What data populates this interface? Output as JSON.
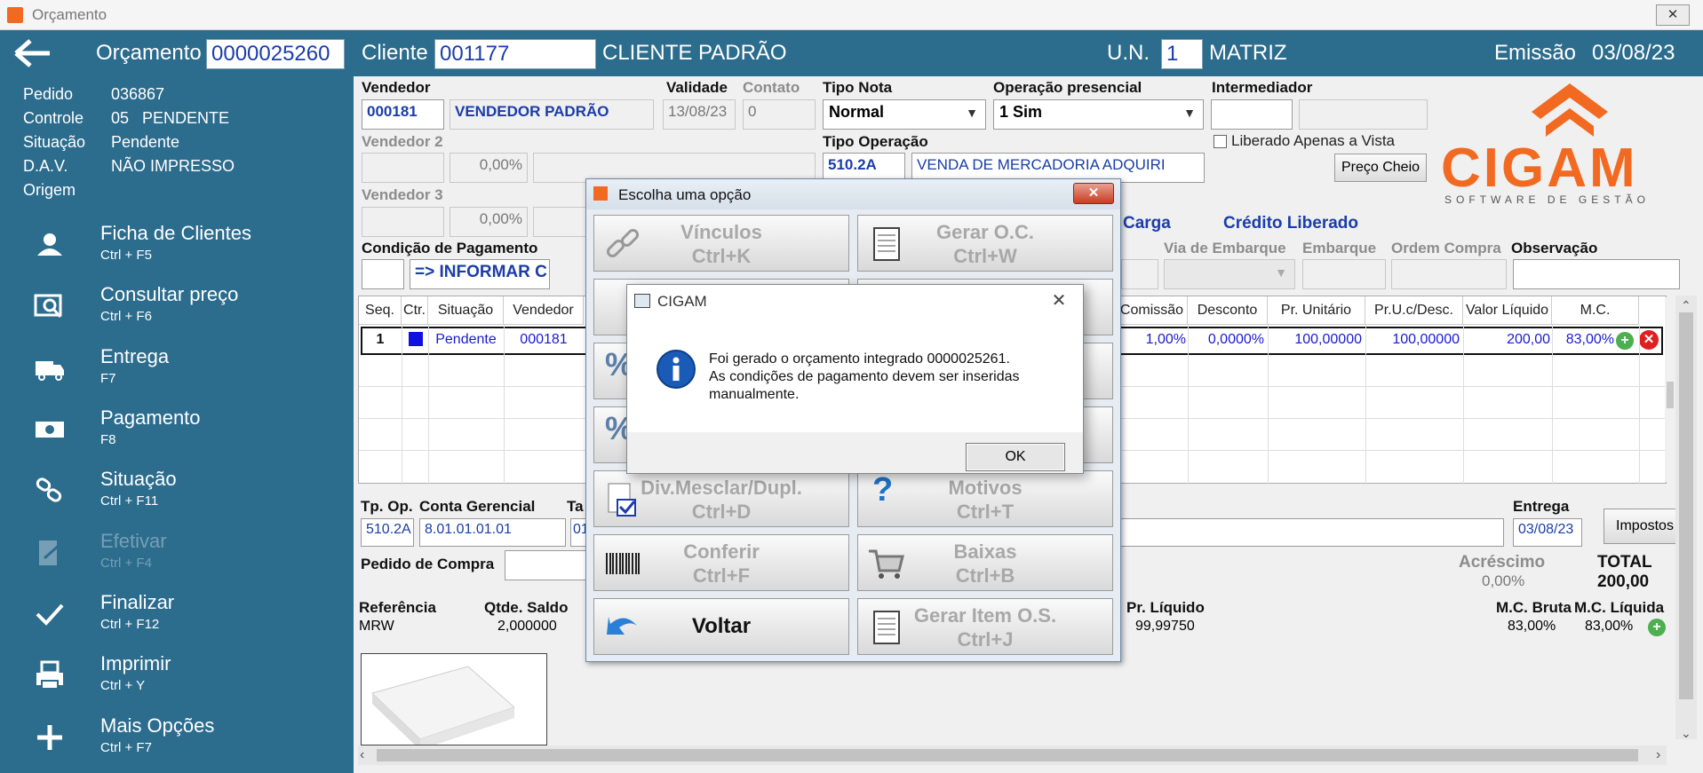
{
  "window": {
    "title": "Orçamento",
    "close_glyph": "✕"
  },
  "header": {
    "back_icon": "arrow-left-icon",
    "orcamento_label": "Orçamento",
    "orcamento_value": "0000025260",
    "cliente_label": "Cliente",
    "cliente_code": "001177",
    "cliente_name": "CLIENTE PADRÃO",
    "un_label": "U.N.",
    "un_value": "1",
    "un_name": "MATRIZ",
    "emissao_label": "Emissão",
    "emissao_value": "03/08/23"
  },
  "sidebar": {
    "info": [
      {
        "label": "Pedido",
        "value": "036867"
      },
      {
        "label": "Controle",
        "value": "05   PENDENTE"
      },
      {
        "label": "Situação",
        "value": "Pendente"
      },
      {
        "label": "D.A.V.",
        "value": "NÃO IMPRESSO"
      },
      {
        "label": "Origem",
        "value": ""
      }
    ],
    "menu": [
      {
        "label": "Ficha de Clientes",
        "shortcut": "Ctrl + F5",
        "icon": "user-icon"
      },
      {
        "label": "Consultar preço",
        "shortcut": "Ctrl + F6",
        "icon": "price-search-icon"
      },
      {
        "label": "Entrega",
        "shortcut": "F7",
        "icon": "delivery-truck-icon"
      },
      {
        "label": "Pagamento",
        "shortcut": "F8",
        "icon": "money-icon"
      },
      {
        "label": "Situação",
        "shortcut": "Ctrl + F11",
        "icon": "link-status-icon"
      },
      {
        "label": "Efetivar",
        "shortcut": "Ctrl + F4",
        "icon": "document-edit-icon"
      },
      {
        "label": "Finalizar",
        "shortcut": "Ctrl + F12",
        "icon": "checkmark-icon"
      },
      {
        "label": "Imprimir",
        "shortcut": "Ctrl + Y",
        "icon": "printer-icon"
      },
      {
        "label": "Mais Opções",
        "shortcut": "Ctrl + F7",
        "icon": "plus-icon"
      }
    ]
  },
  "form": {
    "vendedor_label": "Vendedor",
    "vendedor_code": "000181",
    "vendedor_name": "VENDEDOR PADRÃO",
    "validade_label": "Validade",
    "validade_value": "13/08/23",
    "contato_label": "Contato",
    "contato_value": "0",
    "tipo_nota_label": "Tipo Nota",
    "tipo_nota_value": "Normal",
    "op_presencial_label": "Operação presencial",
    "op_presencial_value": "1 Sim",
    "intermediador_label": "Intermediador",
    "vendedor2_label": "Vendedor 2",
    "vendedor2_pct": "0,00%",
    "tipo_operacao_label": "Tipo Operação",
    "tipo_operacao_code": "510.2A",
    "tipo_operacao_name": "VENDA DE MERCADORIA ADQUIRI",
    "liberado_label": "Liberado Apenas a Vista",
    "preco_cheio_button": "Preço Cheio",
    "vendedor3_label": "Vendedor 3",
    "vendedor3_pct": "0,00%",
    "carga_label": "Carga",
    "credito_label": "Crédito Liberado",
    "condicao_label": "Condição de Pagamento",
    "condicao_value": "=> INFORMAR C",
    "via_embarque_label": "Via de Embarque",
    "embarque_label": "Embarque",
    "ordem_compra_label": "Ordem Compra",
    "observacao_label": "Observação"
  },
  "grid": {
    "headers": [
      "Seq.",
      "Ctr.",
      "Situação",
      "Vendedor",
      "Comissão",
      "Desconto",
      "Pr. Unitário",
      "Pr.U.c/Desc.",
      "Valor Líquido",
      "M.C."
    ],
    "row": {
      "seq": "1",
      "situacao": "Pendente",
      "vendedor": "000181",
      "comissao": "1,00%",
      "desconto": "0,0000%",
      "pr_unitario": "100,00000",
      "pr_desc": "100,00000",
      "valor_liquido": "200,00",
      "mc": "83,00%"
    }
  },
  "bottom": {
    "tp_op_label": "Tp. Op.",
    "tp_op_value": "510.2A",
    "conta_label": "Conta Gerencial",
    "conta_value": "8.01.01.01.01",
    "ta_label": "Ta",
    "ta_value": "01",
    "entrega_label": "Entrega",
    "entrega_value": "03/08/23",
    "impostos_button": "Impostos",
    "pedido_compra_label": "Pedido de Compra",
    "acrescimo_label": "Acréscimo",
    "acrescimo_value": "0,00%",
    "total_label": "TOTAL",
    "total_value": "200,00",
    "referencia_label": "Referência",
    "referencia_value": "MRW",
    "qtde_label": "Qtde. Saldo",
    "qtde_value": "2,000000",
    "pr_liquido_label": "Pr. Líquido",
    "pr_liquido_value": "99,99750",
    "mc_bruta_label": "M.C. Bruta",
    "mc_bruta_value": "83,00%",
    "mc_liquida_label": "M.C. Líquida",
    "mc_liquida_value": "83,00%"
  },
  "options_dialog": {
    "title": "Escolha uma opção",
    "buttons": [
      {
        "label": "Vínculos",
        "shortcut": "Ctrl+K",
        "icon": "chain-link-icon"
      },
      {
        "label": "Gerar O.C.",
        "shortcut": "Ctrl+W",
        "icon": "notepad-icon"
      },
      {
        "label": "Div.Mesclar/Dupl.",
        "shortcut": "Ctrl+D",
        "icon": "document-check-icon"
      },
      {
        "label": "Motivos",
        "shortcut": "Ctrl+T",
        "icon": "question-icon"
      },
      {
        "label": "Conferir",
        "shortcut": "Ctrl+F",
        "icon": "barcode-icon"
      },
      {
        "label": "Baixas",
        "shortcut": "Ctrl+B",
        "icon": "shopping-cart-icon"
      },
      {
        "label": "Voltar",
        "shortcut": "",
        "icon": "undo-arrow-icon"
      },
      {
        "label": "Gerar Item O.S.",
        "shortcut": "Ctrl+J",
        "icon": "notepad-icon"
      }
    ]
  },
  "message_box": {
    "title": "CIGAM",
    "text_line1": "Foi gerado o orçamento integrado 0000025261.",
    "text_line2": "As condições de pagamento devem ser inseridas",
    "text_line3": "manualmente.",
    "ok_button": "OK"
  },
  "logo": {
    "text": "CIGAM",
    "tagline": "SOFTWARE DE GESTÃO"
  },
  "colors": {
    "primary": "#2c6c8d",
    "logo_orange": "#f26a21",
    "link_blue": "#1a3da8"
  }
}
